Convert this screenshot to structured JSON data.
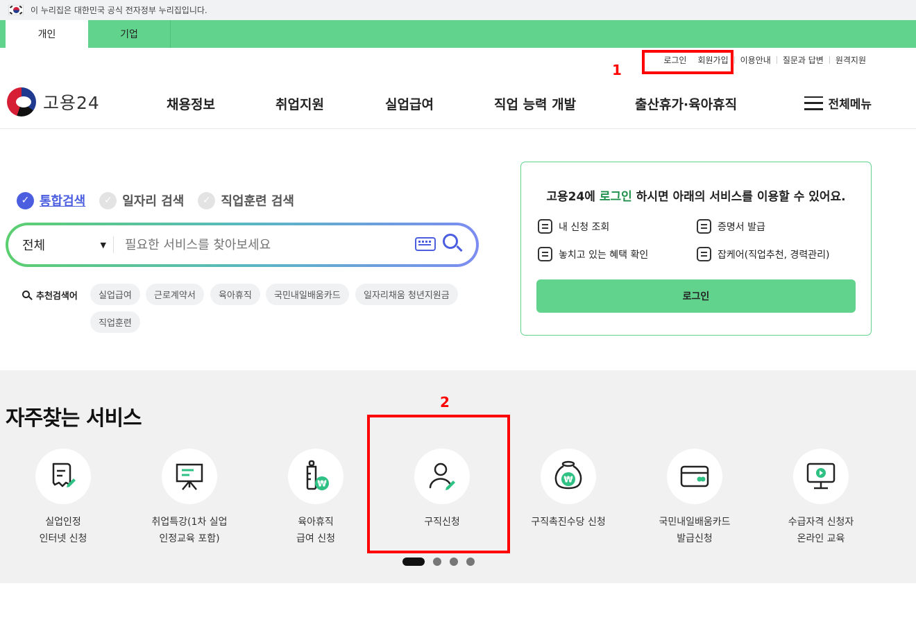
{
  "gov_banner": {
    "text": "이 누리집은 대한민국 공식 전자정부 누리집입니다."
  },
  "top_tabs": [
    {
      "label": "개인"
    },
    {
      "label": "기업"
    }
  ],
  "utility_links": [
    {
      "label": "로그인"
    },
    {
      "label": "회원가입"
    },
    {
      "label": "이용안내"
    },
    {
      "label": "질문과 답변"
    },
    {
      "label": "원격지원"
    }
  ],
  "annotations": {
    "mark1": "1",
    "mark2": "2"
  },
  "logo": {
    "text": "고용24"
  },
  "gnb": [
    {
      "label": "채용정보"
    },
    {
      "label": "취업지원"
    },
    {
      "label": "실업급여"
    },
    {
      "label": "직업 능력 개발"
    },
    {
      "label": "출산휴가·육아휴직"
    }
  ],
  "all_menu": {
    "label": "전체메뉴"
  },
  "search": {
    "tabs": [
      {
        "label": "통합검색",
        "selected": true
      },
      {
        "label": "일자리 검색",
        "selected": false
      },
      {
        "label": "직업훈련 검색",
        "selected": false
      }
    ],
    "category": "전체",
    "placeholder": "필요한 서비스를 찾아보세요",
    "recommend_label": "추천검색어",
    "keywords": [
      "실업급여",
      "근로계약서",
      "육아휴직",
      "국민내일배움카드",
      "일자리채움 청년지원금",
      "직업훈련"
    ]
  },
  "login_card": {
    "title_before": "고용24에 ",
    "title_highlight": "로그인",
    "title_after": " 하시면 아래의 서비스를 이용할 수 있어요.",
    "items": [
      "내 신청 조회",
      "증명서 발급",
      "놓치고 있는 혜택 확인",
      "잡케어(직업추천, 경력관리)"
    ],
    "button": "로그인"
  },
  "frequent": {
    "title": "자주찾는 서비스",
    "services": [
      {
        "line1": "실업인정",
        "line2": "인터넷 신청",
        "icon": "document-pen-icon"
      },
      {
        "line1": "취업특강(1차 실업",
        "line2": "인정교육 포함)",
        "icon": "presentation-board-icon"
      },
      {
        "line1": "육아휴직",
        "line2": "급여 신청",
        "icon": "baby-bottle-won-icon"
      },
      {
        "line1": "구직신청",
        "line2": "",
        "icon": "person-pen-icon"
      },
      {
        "line1": "구직촉진수당 신청",
        "line2": "",
        "icon": "money-bag-won-icon"
      },
      {
        "line1": "국민내일배움카드",
        "line2": "발급신청",
        "icon": "card-icon"
      },
      {
        "line1": "수급자격 신청자",
        "line2": "온라인 교육",
        "icon": "monitor-play-icon"
      }
    ],
    "pages": 4,
    "current_page": 1
  },
  "colors": {
    "brand_green": "#61d38c",
    "accent_blue": "#4b5ee0",
    "highlight_red": "#ff0000",
    "icon_green": "#2fc184"
  }
}
